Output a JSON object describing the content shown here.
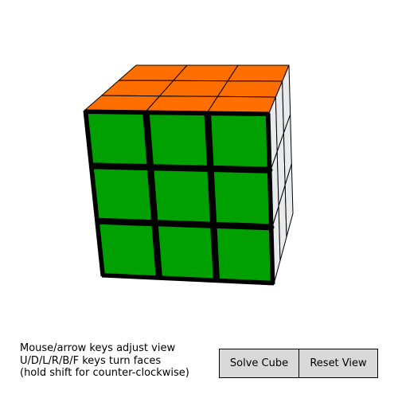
{
  "instructions": {
    "line1": "Mouse/arrow keys adjust view",
    "line2": "U/D/L/R/B/F keys turn faces",
    "line3": "(hold shift for counter-clockwise)"
  },
  "buttons": {
    "solve_label": "Solve Cube",
    "reset_label": "Reset View"
  },
  "cube": {
    "size": 3,
    "state": "solved",
    "visible_faces": [
      "front",
      "top",
      "right"
    ],
    "face_colors": {
      "front": "#00a000",
      "top": "#ff6f00",
      "right": "#e8eaec"
    },
    "sticker_border_color": "#000000"
  }
}
